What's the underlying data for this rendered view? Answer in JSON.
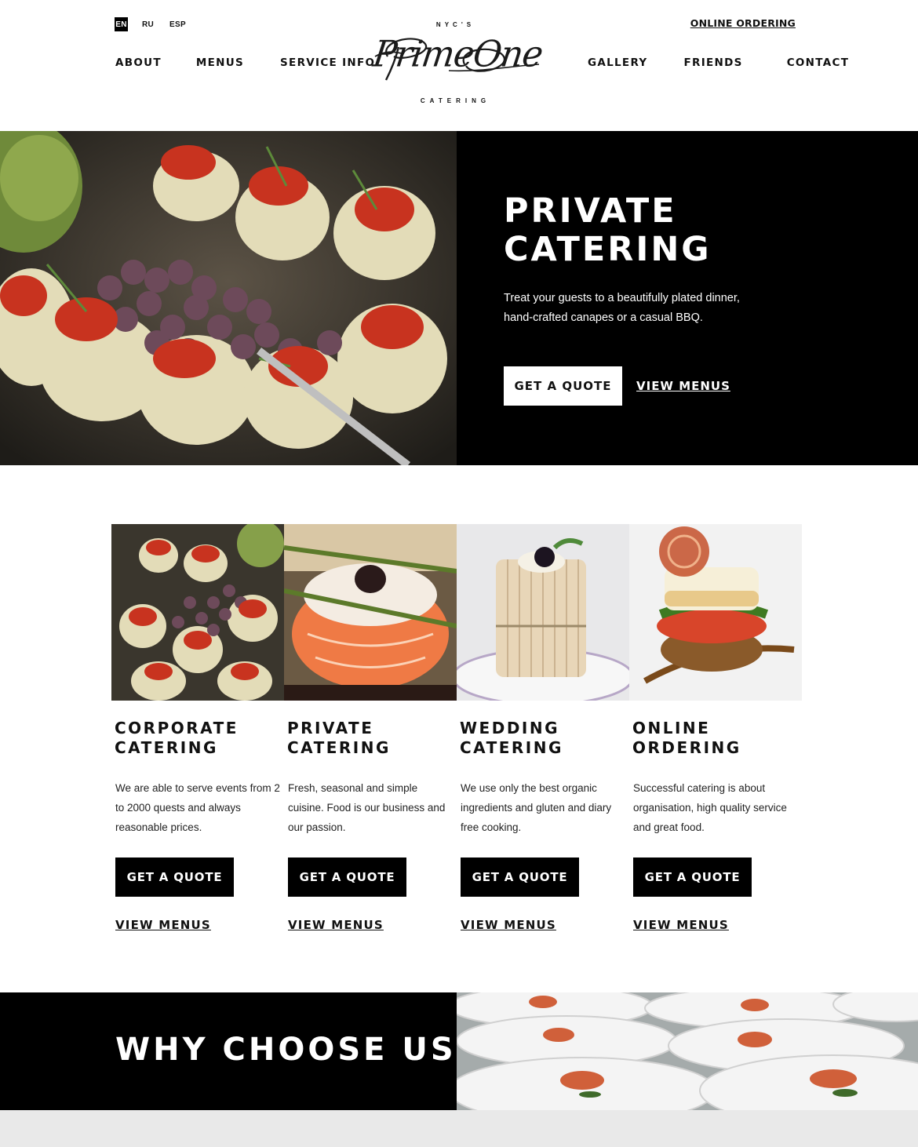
{
  "header": {
    "languages": [
      {
        "label": "EN",
        "active": true
      },
      {
        "label": "RU",
        "active": false
      },
      {
        "label": "ESP",
        "active": false
      }
    ],
    "online_ordering": "ONLINE ORDERING",
    "nav_left": [
      "ABOUT",
      "MENUS",
      "SERVICE INFO"
    ],
    "nav_right": [
      "GALLERY",
      "FRIENDS",
      "CONTACT"
    ],
    "logo": {
      "top_tag": "NYC'S",
      "script": "PrimeOne",
      "bottom_tag": "CATERING"
    }
  },
  "hero": {
    "title_line1": "PRIVATE",
    "title_line2": "CATERING",
    "description": "Treat your guests to a beautifully plated dinner, hand-crafted canapes or a casual BBQ.",
    "quote_button": "GET A QUOTE",
    "menus_link": "VIEW MENUS"
  },
  "services": [
    {
      "title_line1": "CORPORATE",
      "title_line2": "CATERING",
      "text": "We are able to serve events from 2 to 2000 quests and always reasonable prices.",
      "quote_button": "GET A QUOTE",
      "menus_link": "VIEW MENUS"
    },
    {
      "title_line1": "PRIVATE",
      "title_line2": "CATERING",
      "text": "Fresh, seasonal and simple cuisine. Food is our business and our passion.",
      "quote_button": "GET A QUOTE",
      "menus_link": "VIEW MENUS"
    },
    {
      "title_line1": "WEDDING",
      "title_line2": "CATERING",
      "text": "We use only the best organic ingredients and gluten and diary free cooking.",
      "quote_button": "GET A QUOTE",
      "menus_link": "VIEW MENUS"
    },
    {
      "title_line1": "ONLINE",
      "title_line2": "ORDERING",
      "text": "Successful catering is about organisation, high quality service and great food.",
      "quote_button": "GET A QUOTE",
      "menus_link": "VIEW MENUS"
    }
  ],
  "why": {
    "title": "WHY CHOOSE US?"
  },
  "colors": {
    "primary": "#000000",
    "background": "#ffffff",
    "footer_band": "#e9e9e9"
  }
}
